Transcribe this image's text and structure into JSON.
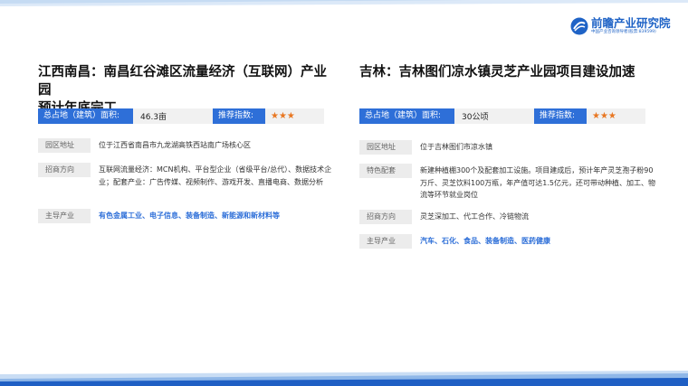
{
  "brand": {
    "name": "前瞻产业研究院",
    "tagline": "中国产业咨询领导者(股票:839599)"
  },
  "left": {
    "title_line1": "江西南昌：南昌红谷滩区流量经济（互联网）产业园",
    "title_line2": "预计年底完工",
    "area_label": "总占地（建筑）面积:",
    "area_value": "46.3亩",
    "rec_label": "推荐指数:",
    "stars": "★★★",
    "rows": [
      {
        "tag": "园区地址",
        "value": "位于江西省南昌市九龙湖高铁西站南广场核心区"
      },
      {
        "tag": "招商方向",
        "value": "互联网流量经济：MCN机构、平台型企业（省级平台/总代）、数据技术企业；配套产业：广告传媒、视频制作、游戏开发、直播电商、数据分析"
      },
      {
        "tag": "主导产业",
        "value": "有色金属工业、电子信息、装备制造、新能源和新材料等"
      }
    ]
  },
  "right": {
    "title_line1": "吉林：吉林图们凉水镇灵芝产业园项目建设加速",
    "area_label": "总占地（建筑）面积:",
    "area_value": "30公顷",
    "rec_label": "推荐指数:",
    "stars": "★★★",
    "rows": [
      {
        "tag": "园区地址",
        "value": "位于吉林图们市凉水镇"
      },
      {
        "tag": "特色配套",
        "value": "新建种植棚300个及配套加工设施。项目建成后，预计年产灵芝孢子粉90万斤、灵芝饮料100万瓶，年产值可达1.5亿元，还可带动种植、加工、物流等环节就业岗位"
      },
      {
        "tag": "招商方向",
        "value": "灵芝深加工、代工合作、冷链物流"
      },
      {
        "tag": "主导产业",
        "value": "汽车、石化、食品、装备制造、医药健康"
      }
    ]
  },
  "colors": {
    "accent": "#2e6fd8",
    "star": "#e87722",
    "band_light": "#bcd6f2",
    "band_dark": "#1f5fc4"
  }
}
